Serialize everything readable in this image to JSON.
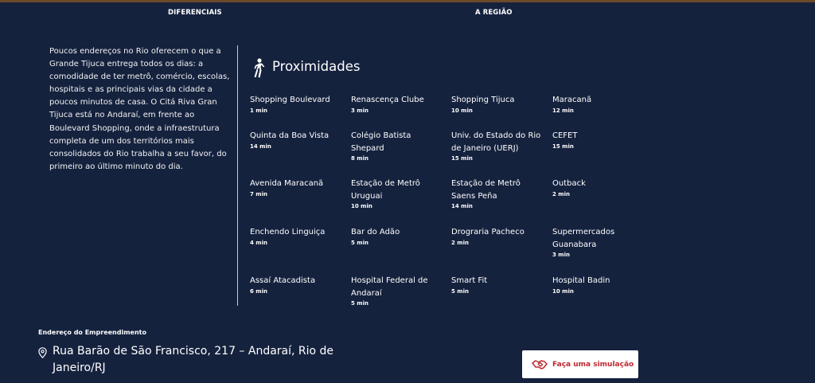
{
  "tabs": {
    "diferenciais": "DIFERENCIAIS",
    "regiao": "A REGIÃO"
  },
  "intro": "Poucos endereços no Rio oferecem o que a Grande Tijuca entrega todos os dias: a comodidade de ter metrô, comércio, escolas, hospitais e as principais vias da cidade a poucos minutos de casa. O Citá Riva Gran Tijuca está no Andaraí, em frente ao Boulevard Shopping, onde a infraestrutura completa de um dos territórios mais consolidados do Rio trabalha a seu favor, do primeiro ao último minuto do dia.",
  "proximidades": {
    "title": "Proximidades",
    "items": [
      {
        "name": "Shopping Boulevard",
        "time": "1 min"
      },
      {
        "name": "Renascença Clube",
        "time": "3 min"
      },
      {
        "name": "Shopping Tijuca",
        "time": "10 min"
      },
      {
        "name": "Maracanã",
        "time": "12 min"
      },
      {
        "name": "Quinta da Boa Vista",
        "time": "14 min"
      },
      {
        "name": "Colégio Batista Shepard",
        "time": "8 min"
      },
      {
        "name": "Univ. do Estado do Rio de Janeiro (UERJ)",
        "time": "15 min"
      },
      {
        "name": "CEFET",
        "time": "15 min"
      },
      {
        "name": "Avenida Maracanã",
        "time": "7 min"
      },
      {
        "name": "Estação de Metrô Uruguai",
        "time": "10 min"
      },
      {
        "name": "Estação de Metrô Saens Peña",
        "time": "14 min"
      },
      {
        "name": "Outback",
        "time": "2 min"
      },
      {
        "name": "Enchendo Linguiça",
        "time": "4 min"
      },
      {
        "name": "Bar do Adão",
        "time": "5 min"
      },
      {
        "name": "Drograria Pacheco",
        "time": "2 min"
      },
      {
        "name": "Supermercados Guanabara",
        "time": "3 min"
      },
      {
        "name": "Assaí Atacadista",
        "time": "6 min"
      },
      {
        "name": "Hospital Federal de Andaraí",
        "time": "5 min"
      },
      {
        "name": "Smart Fit",
        "time": "5 min"
      },
      {
        "name": "Hospital Badin",
        "time": "10 min"
      }
    ]
  },
  "address": {
    "label": "Endereço do Empreendimento",
    "text": "Rua Barão de São Francisco, 217 – Andaraí, Rio de Janeiro/RJ"
  },
  "cta": {
    "label": "Faça uma simulação"
  },
  "colors": {
    "background": "#15223e",
    "accent": "#c0282e",
    "topbar": "#6b4a2b"
  },
  "icons": {
    "proximidades": "walking-person-icon",
    "address": "location-pin-icon",
    "cta": "handshake-icon"
  }
}
